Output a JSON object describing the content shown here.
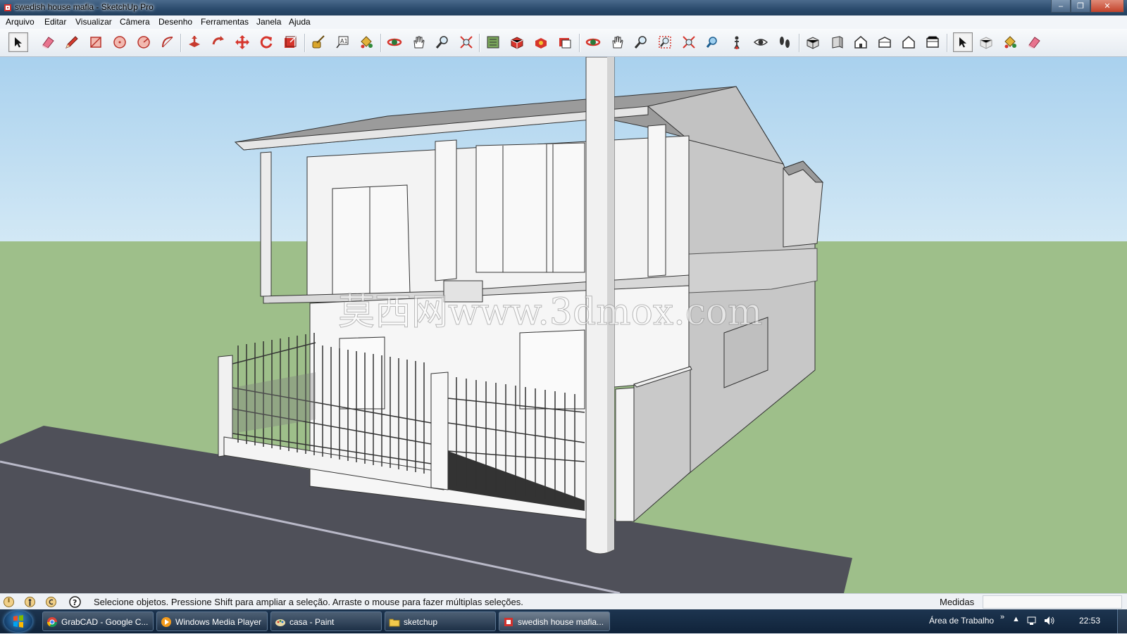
{
  "window": {
    "title": "swedish house mafia - SketchUp Pro",
    "controls": [
      "–",
      "❐",
      "✕"
    ]
  },
  "menu": [
    {
      "label": "Arquivo"
    },
    {
      "label": "Editar"
    },
    {
      "label": "Visualizar"
    },
    {
      "label": "Câmera"
    },
    {
      "label": "Desenho"
    },
    {
      "label": "Ferramentas"
    },
    {
      "label": "Janela"
    },
    {
      "label": "Ajuda"
    }
  ],
  "toolbar": [
    "select-arrow-icon",
    "eraser-icon",
    "pencil-icon",
    "rectangle-icon",
    "circle-icon",
    "polygon-icon",
    "arc-icon",
    "push-pull-icon",
    "follow-me-icon",
    "move-icon",
    "rotate-icon",
    "scale-icon",
    "tape-measure-icon",
    "text-icon",
    "paint-bucket-icon",
    "orbit-icon",
    "pan-icon",
    "zoom-icon",
    "zoom-extents-icon",
    "warehouse-icon",
    "share-model-icon",
    "components-icon",
    "photo-textures-icon",
    "orbit-icon",
    "pan-icon",
    "zoom-icon",
    "zoom-window-icon",
    "zoom-extents-icon",
    "previous-view-icon",
    "position-camera-icon",
    "look-around-icon",
    "walk-icon",
    "iso-view-icon",
    "front-view-icon",
    "top-view-icon",
    "right-view-icon",
    "back-view-icon",
    "left-view-icon",
    "select-arrow-icon",
    "make-component-icon",
    "paint-bucket-icon",
    "eraser-icon"
  ],
  "watermark": "莫西网www.3dmox.com",
  "status": {
    "text": "Selecione objetos. Pressione Shift para ampliar a seleção. Arraste o mouse para fazer múltiplas seleções.",
    "measurements_label": "Medidas"
  },
  "taskbar": {
    "items": [
      {
        "label": "GrabCAD - Google C...",
        "icon": "chrome-icon"
      },
      {
        "label": "Windows Media Player",
        "icon": "media-player-icon"
      },
      {
        "label": "casa - Paint",
        "icon": "paint-icon"
      },
      {
        "label": "sketchup",
        "icon": "folder-icon"
      },
      {
        "label": "swedish house mafia...",
        "icon": "sketchup-icon"
      }
    ],
    "toolbar_label": "Área de Trabalho",
    "chevron": "»",
    "clock": "22:53"
  },
  "colors": {
    "sky": "#b9d9ef",
    "ground": "#9ebf8a",
    "road": "#4f5059",
    "wall": "#f6f6f6",
    "shade": "#c9c9c9",
    "accent": "#d2322d"
  }
}
